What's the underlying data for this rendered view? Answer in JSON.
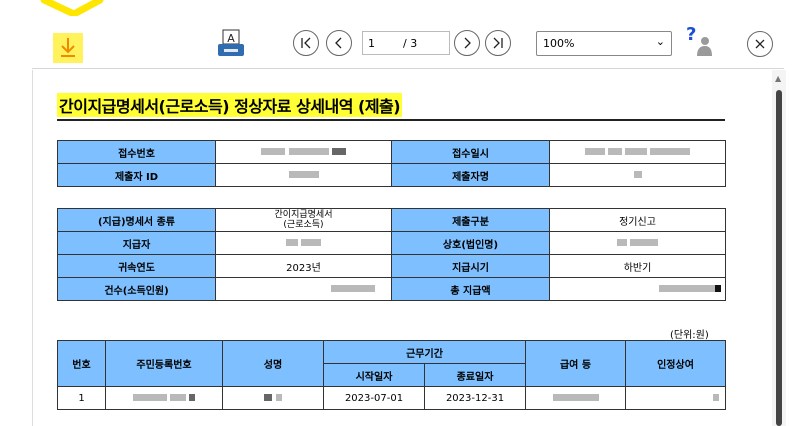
{
  "toolbar": {
    "page_current": "1",
    "page_total": "/ 3",
    "zoom": "100%",
    "help_label": "?",
    "icons": [
      "download-icon",
      "print-icon",
      "first-page-icon",
      "prev-page-icon",
      "next-page-icon",
      "last-page-icon",
      "help-icon",
      "close-icon"
    ]
  },
  "document": {
    "title": "간이지급명세서(근로소득) 정상자료 상세내역 (제출)",
    "table1": {
      "receipt_no_label": "접수번호",
      "receipt_date_label": "접수일시",
      "submitter_id_label": "제출자 ID",
      "submitter_name_label": "제출자명"
    },
    "table2": {
      "statement_type_label": "(지급)명세서 종류",
      "statement_type_value_1": "간이지급명세서",
      "statement_type_value_2": "(근로소득)",
      "submit_category_label": "제출구분",
      "submit_category_value": "정기신고",
      "payer_label": "지급자",
      "company_label": "상호(법인명)",
      "year_label": "귀속연도",
      "year_value": "2023년",
      "pay_period_label": "지급시기",
      "pay_period_value": "하반기",
      "count_label": "건수(소득인원)",
      "total_label": "총 지급액"
    },
    "unit": "(단위:원)",
    "table3": {
      "headers": {
        "no": "번호",
        "resident_no": "주민등록번호",
        "name": "성명",
        "work_period": "근무기간",
        "start_date": "시작일자",
        "end_date": "종료일자",
        "salary": "급여 등",
        "approved_bonus": "인정상여"
      },
      "rows": [
        {
          "no": "1",
          "start": "2023-07-01",
          "end": "2023-12-31"
        }
      ]
    }
  }
}
